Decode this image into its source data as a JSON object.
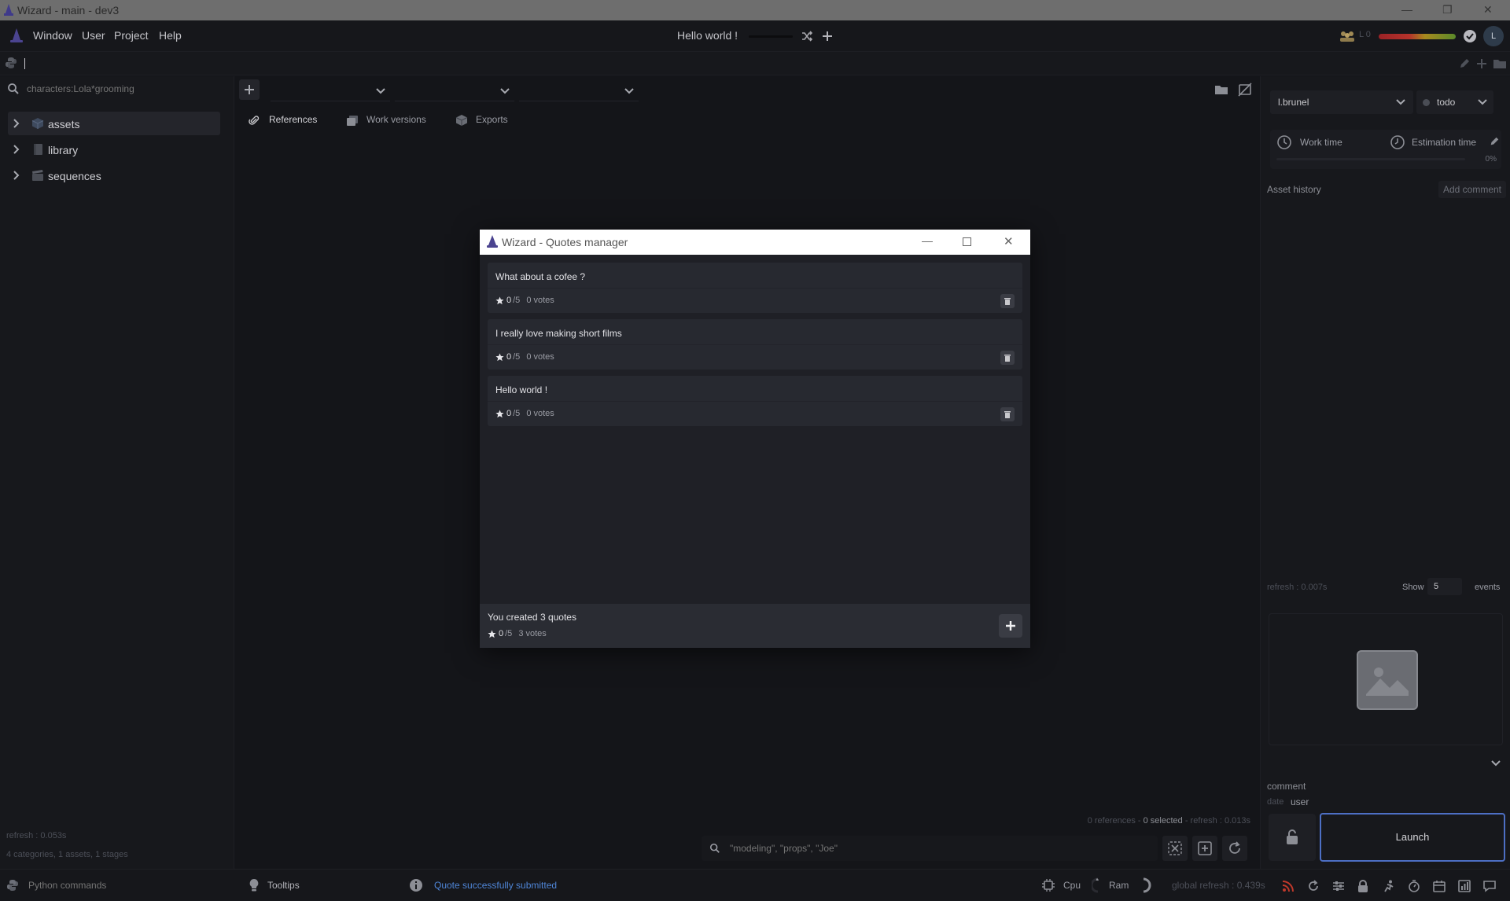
{
  "os_title": "Wizard - main - dev3",
  "menu": {
    "items": [
      "Window",
      "User",
      "Project",
      "Help"
    ],
    "center_quote": "Hello world !",
    "user_level": "L 0",
    "avatar_letter": "L"
  },
  "left": {
    "search_placeholder": "characters:Lola*grooming",
    "tree": [
      "assets",
      "library",
      "sequences"
    ],
    "refresh": "refresh : 0.053s",
    "summary": "4 categories, 1 assets, 1 stages"
  },
  "center": {
    "tabs": [
      "References",
      "Work versions",
      "Exports"
    ],
    "refs_status_prefix": "0 references - ",
    "refs_status_selected": "0 selected",
    "refs_status_suffix": " - refresh : 0.013s",
    "search_placeholder": "\"modeling\", \"props\", \"Joe\""
  },
  "right": {
    "user": "l.brunel",
    "state": "todo",
    "work_time_label": "Work time",
    "estimation_label": "Estimation time",
    "progress_label": "0%",
    "progress": 0,
    "history_title": "Asset history",
    "add_comment_label": "Add comment",
    "refresh": "refresh : 0.007s",
    "show_label": "Show",
    "show_value": "5",
    "events_label": "events",
    "comment_label": "comment",
    "date_label": "date",
    "user_label": "user",
    "launch_label": "Launch"
  },
  "statusbar": {
    "python_placeholder": "Python commands",
    "tooltips_label": "Tooltips",
    "message": "Quote successfully submitted",
    "cpu_label": "Cpu",
    "ram_label": "Ram",
    "global_refresh": "global refresh : 0.439s"
  },
  "modal": {
    "title": "Wizard - Quotes manager",
    "quotes": [
      {
        "text": "What about a cofee ?",
        "score": "0",
        "max": "/5",
        "votes": "0 votes"
      },
      {
        "text": "I really love making short films",
        "score": "0",
        "max": "/5",
        "votes": "0 votes"
      },
      {
        "text": "Hello world !",
        "score": "0",
        "max": "/5",
        "votes": "0 votes"
      }
    ],
    "footer_title": "You created 3 quotes",
    "footer_score": "0",
    "footer_max": "/5",
    "footer_votes": "3 votes"
  },
  "colors": {
    "accent_blue": "#4f86d8",
    "launch_border": "#4d6fc4",
    "danger": "#c0392b"
  }
}
